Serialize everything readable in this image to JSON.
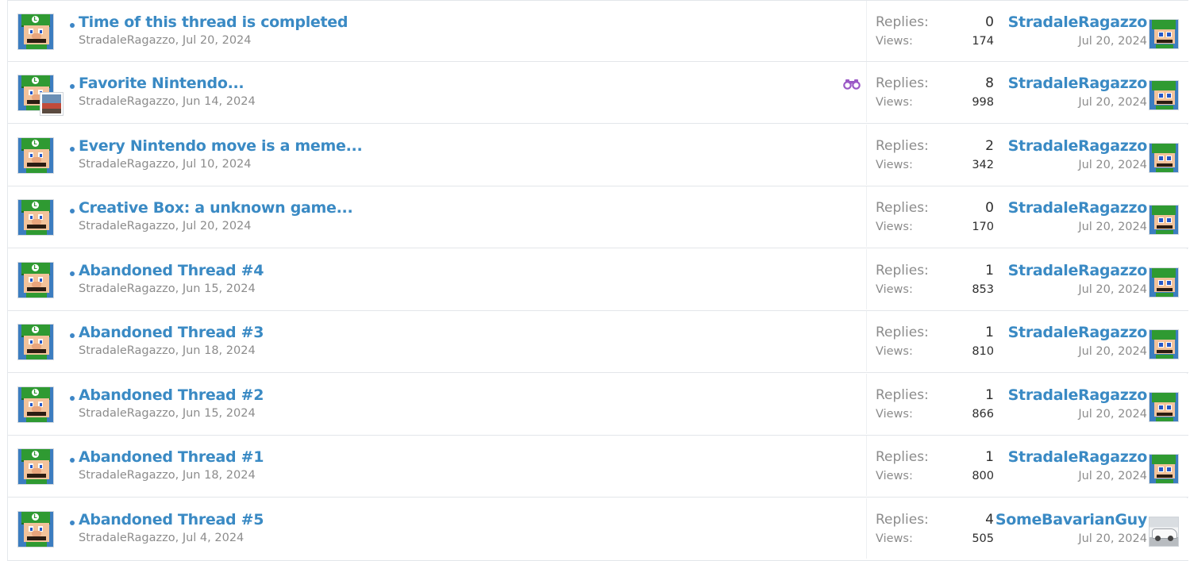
{
  "labels": {
    "replies": "Replies:",
    "views": "Views:"
  },
  "threads": [
    {
      "title": "Time of this thread is completed",
      "author": "StradaleRagazzo",
      "sep": ",",
      "date": "Jul 20, 2024",
      "replies": "0",
      "views": "174",
      "last_user": "StradaleRagazzo",
      "last_date": "Jul 20, 2024"
    },
    {
      "title": "Favorite Nintendo...",
      "author": "StradaleRagazzo",
      "sep": ",",
      "date": "Jun 14, 2024",
      "replies": "8",
      "views": "998",
      "last_user": "StradaleRagazzo",
      "last_date": "Jul 20, 2024",
      "watched_icon": "binoculars-icon"
    },
    {
      "title": "Every Nintendo move is a meme...",
      "author": "StradaleRagazzo",
      "sep": ",",
      "date": "Jul 10, 2024",
      "replies": "2",
      "views": "342",
      "last_user": "StradaleRagazzo",
      "last_date": "Jul 20, 2024"
    },
    {
      "title": "Creative Box: a unknown game...",
      "author": "StradaleRagazzo",
      "sep": ",",
      "date": "Jul 20, 2024",
      "replies": "0",
      "views": "170",
      "last_user": "StradaleRagazzo",
      "last_date": "Jul 20, 2024"
    },
    {
      "title": "Abandoned Thread #4",
      "author": "StradaleRagazzo",
      "sep": ",",
      "date": "Jun 15, 2024",
      "replies": "1",
      "views": "853",
      "last_user": "StradaleRagazzo",
      "last_date": "Jul 20, 2024"
    },
    {
      "title": "Abandoned Thread #3",
      "author": "StradaleRagazzo",
      "sep": ",",
      "date": "Jun 18, 2024",
      "replies": "1",
      "views": "810",
      "last_user": "StradaleRagazzo",
      "last_date": "Jul 20, 2024"
    },
    {
      "title": "Abandoned Thread #2",
      "author": "StradaleRagazzo",
      "sep": ",",
      "date": "Jun 15, 2024",
      "replies": "1",
      "views": "866",
      "last_user": "StradaleRagazzo",
      "last_date": "Jul 20, 2024"
    },
    {
      "title": "Abandoned Thread #1",
      "author": "StradaleRagazzo",
      "sep": ",",
      "date": "Jun 18, 2024",
      "replies": "1",
      "views": "800",
      "last_user": "StradaleRagazzo",
      "last_date": "Jul 20, 2024"
    },
    {
      "title": "Abandoned Thread #5",
      "author": "StradaleRagazzo",
      "sep": ",",
      "date": "Jul 4, 2024",
      "replies": "4",
      "views": "505",
      "last_user": "SomeBavarianGuy",
      "last_date": "Jul 20, 2024"
    }
  ],
  "colors": {
    "link": "#3a8ac4",
    "muted": "#8c8c8c",
    "unread_dot": "#3d86c6",
    "watch_icon": "#9b59c6"
  }
}
